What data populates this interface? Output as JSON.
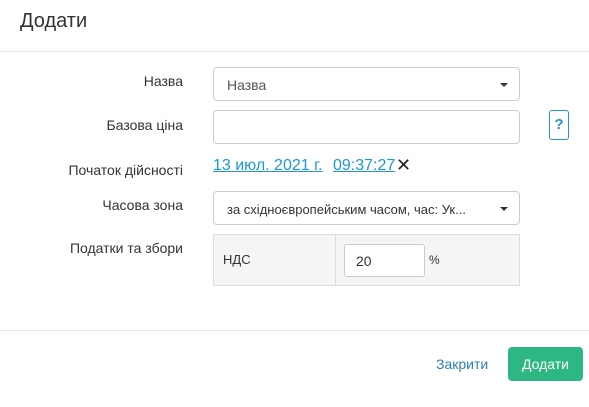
{
  "dialog": {
    "title": "Додати"
  },
  "fields": {
    "name": {
      "label": "Назва",
      "placeholder": "Назва"
    },
    "base_price": {
      "label": "Базова ціна",
      "value": "",
      "help_icon": "question-icon"
    },
    "valid_from": {
      "label": "Початок дійсності",
      "date": "13 июл. 2021 г.",
      "time": "09:37:27",
      "clear_icon": "close-icon"
    },
    "timezone": {
      "label": "Часова зона",
      "selected": "за східноєвропейським часом, час: Ук..."
    },
    "taxes": {
      "label": "Податки та збори",
      "rows": [
        {
          "name": "НДС",
          "value": "20",
          "unit": "%"
        }
      ]
    }
  },
  "footer": {
    "close_label": "Закрити",
    "add_label": "Додати"
  },
  "colors": {
    "accent_link": "#1a98d8",
    "primary_button": "#2db883",
    "close_link": "#2f7fb5"
  }
}
